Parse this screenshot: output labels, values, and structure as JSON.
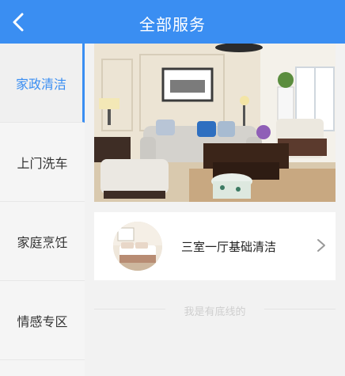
{
  "header": {
    "title": "全部服务",
    "back_icon": "chevron-left-icon"
  },
  "sidebar": {
    "items": [
      {
        "label": "家政清洁",
        "active": true
      },
      {
        "label": "上门洗车",
        "active": false
      },
      {
        "label": "家庭烹饪",
        "active": false
      },
      {
        "label": "情感专区",
        "active": false
      }
    ]
  },
  "main": {
    "service": {
      "title": "三室一厅基础清洁",
      "arrow_icon": "chevron-right-icon"
    },
    "footer_text": "我是有底线的"
  },
  "colors": {
    "accent": "#3a8ef2",
    "background": "#f2f2f2"
  }
}
